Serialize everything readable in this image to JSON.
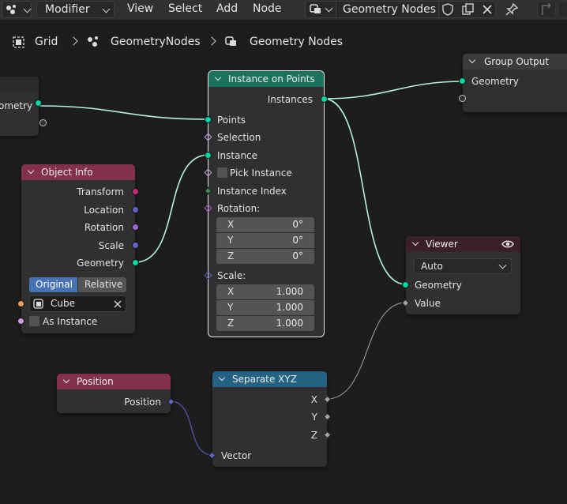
{
  "header": {
    "editor_type": "Modifier",
    "menus": [
      "View",
      "Select",
      "Add",
      "Node"
    ],
    "node_tree_name": "Geometry Nodes"
  },
  "breadcrumb": [
    "Grid",
    "GeometryNodes",
    "Geometry Nodes"
  ],
  "nodes": {
    "left_partial": {
      "output": "ometry"
    },
    "group_output": {
      "title": "Group Output",
      "input": "Geometry"
    },
    "instance_on_points": {
      "title": "Instance on Points",
      "output": "Instances",
      "inputs": {
        "points": "Points",
        "selection": "Selection",
        "instance": "Instance",
        "pick_instance": "Pick Instance",
        "instance_index": "Instance Index",
        "rotation": "Rotation:",
        "scale": "Scale:"
      },
      "rotation": [
        {
          "axis": "X",
          "value": "0°"
        },
        {
          "axis": "Y",
          "value": "0°"
        },
        {
          "axis": "Z",
          "value": "0°"
        }
      ],
      "scale": [
        {
          "axis": "X",
          "value": "1.000"
        },
        {
          "axis": "Y",
          "value": "1.000"
        },
        {
          "axis": "Z",
          "value": "1.000"
        }
      ]
    },
    "object_info": {
      "title": "Object Info",
      "outputs": [
        "Transform",
        "Location",
        "Rotation",
        "Scale",
        "Geometry"
      ],
      "mode_options": [
        "Original",
        "Relative"
      ],
      "mode_selected": "Original",
      "object": "Cube",
      "as_instance": "As Instance"
    },
    "viewer": {
      "title": "Viewer",
      "domain": "Auto",
      "inputs": [
        "Geometry",
        "Value"
      ]
    },
    "position": {
      "title": "Position",
      "output": "Position"
    },
    "separate_xyz": {
      "title": "Separate XYZ",
      "outputs": [
        "X",
        "Y",
        "Z"
      ],
      "input": "Vector"
    }
  },
  "colors": {
    "background": "#1d1d1d",
    "geometry_socket": "#00d6a3",
    "vector_socket": "#6363c7",
    "float_socket": "#a1a1a1",
    "rotation_socket": "#a363d9",
    "object_socket": "#ed9e5c",
    "matrix_socket": "#c7297a",
    "header_geometry": "#1d725e",
    "header_input": "#83314a",
    "header_output": "#3b3b3b",
    "header_viewer": "#3b1f29",
    "header_converter": "#246283",
    "link_geometry": "#b2f2dd",
    "link_vector": "#5252a8",
    "link_float": "#9a9a9a"
  }
}
